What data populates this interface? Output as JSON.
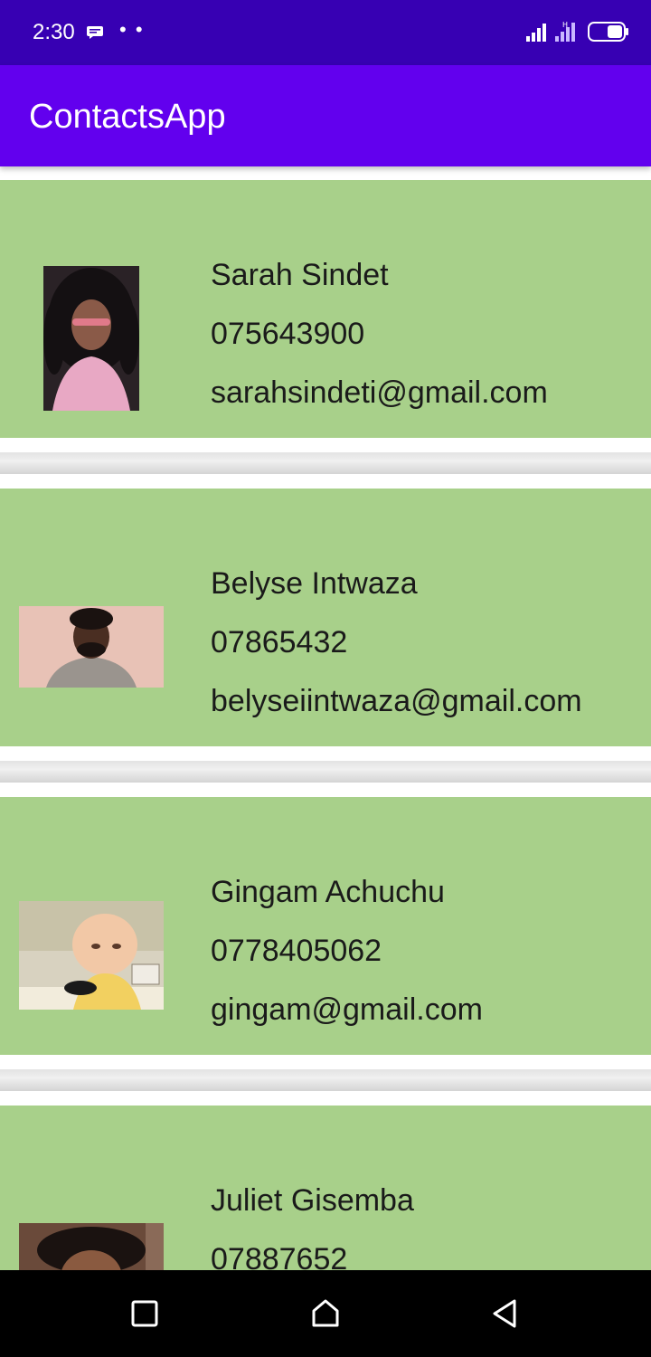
{
  "status_bar": {
    "time": "2:30",
    "dots": "• •",
    "icons": [
      "message-icon",
      "signal-icon",
      "signal-alt-icon",
      "battery-icon"
    ]
  },
  "app_bar": {
    "title": "ContactsApp",
    "color": "#6200ee",
    "status_color": "#3700b3"
  },
  "card_color": "#a8d08a",
  "contacts": [
    {
      "name": "Sarah Sindet",
      "phone": "075643900",
      "email": "sarahsindeti@gmail.com"
    },
    {
      "name": "Belyse Intwaza",
      "phone": "07865432",
      "email": "belyseiintwaza@gmail.com"
    },
    {
      "name": "Gingam Achuchu",
      "phone": "0778405062",
      "email": "gingam@gmail.com"
    },
    {
      "name": "Juliet Gisemba",
      "phone": "07887652",
      "email": ""
    }
  ],
  "nav_bar": {
    "icons": [
      "recents-square-icon",
      "home-icon",
      "back-icon"
    ]
  }
}
